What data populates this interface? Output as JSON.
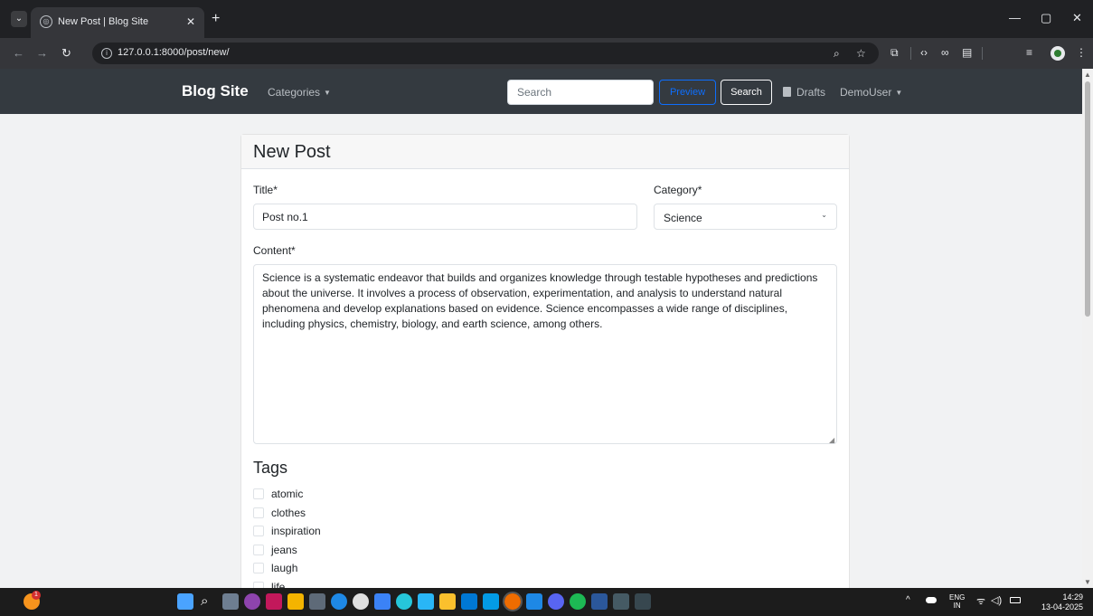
{
  "browser": {
    "tab_title": "New Post | Blog Site",
    "url": "127.0.0.1:8000/post/new/"
  },
  "navbar": {
    "brand": "Blog Site",
    "categories_label": "Categories",
    "search_placeholder": "Search",
    "preview_label": "Preview",
    "search_button": "Search",
    "drafts_label": "Drafts",
    "user_label": "DemoUser"
  },
  "form": {
    "heading": "New Post",
    "title_label": "Title*",
    "title_value": "Post no.1",
    "category_label": "Category*",
    "category_value": "Science",
    "content_label": "Content*",
    "content_value": "Science is a systematic endeavor that builds and organizes knowledge through testable hypotheses and predictions about the universe. It involves a process of observation, experimentation, and analysis to understand natural phenomena and develop explanations based on evidence. Science encompasses a wide range of disciplines, including physics, chemistry, biology, and earth science, among others.",
    "tags_heading": "Tags",
    "tags": [
      "atomic",
      "clothes",
      "inspiration",
      "jeans",
      "laugh",
      "life"
    ]
  },
  "taskbar": {
    "lang_top": "ENG",
    "lang_bottom": "IN",
    "time": "14:29",
    "date": "13-04-2025",
    "notification_count": "1"
  },
  "colors": {
    "navbar_bg": "#343a40",
    "primary": "#0d6efd",
    "browser_chrome": "#202124"
  },
  "icons": [
    "tab-search-icon",
    "globe-icon",
    "close-icon",
    "plus-icon",
    "back-icon",
    "forward-icon",
    "reload-icon",
    "info-icon",
    "zoom-icon",
    "star-icon",
    "extensions-icon",
    "code-icon",
    "link-icon",
    "reader-icon",
    "media-icon",
    "profile-icon",
    "caret-down-icon",
    "document-icon",
    "chevron-down-icon"
  ]
}
